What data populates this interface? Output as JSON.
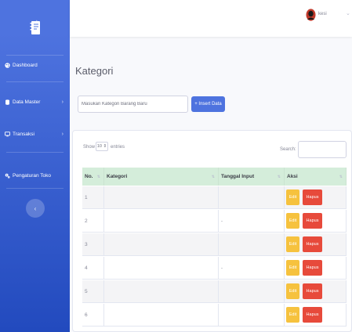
{
  "sidebar": {
    "brand_icon": "notebook-icon",
    "items": [
      {
        "label": "Dashboard",
        "icon": "palette-icon",
        "has_chevron": false
      },
      {
        "label": "Data Master",
        "icon": "database-icon",
        "has_chevron": true,
        "chevron": "›"
      },
      {
        "label": "Transaksi",
        "icon": "desktop-icon",
        "has_chevron": true,
        "chevron": "›"
      },
      {
        "label": "Pengaturan Toko",
        "icon": "cogs-icon",
        "has_chevron": false
      }
    ],
    "toggle_glyph": "‹"
  },
  "topbar": {
    "user_name": "kesi",
    "chevron": "⌄"
  },
  "main": {
    "page_title": "Kategori",
    "insert": {
      "placeholder": "Masukan Kategori Barang Baru",
      "button_label": "+ Insert Data"
    },
    "table": {
      "show_label": "Show",
      "page_size": "10 ⇕",
      "entries_label": "entries",
      "search_label": "Search:",
      "sort_glyph": "⇅",
      "columns": [
        "No.",
        "Kategori",
        "Tanggal Input",
        "Aksi"
      ],
      "rows": [
        {
          "no": "1",
          "kategori": "",
          "tanggal": ""
        },
        {
          "no": "2",
          "kategori": "",
          "tanggal": "-"
        },
        {
          "no": "3",
          "kategori": "",
          "tanggal": ""
        },
        {
          "no": "4",
          "kategori": "",
          "tanggal": "-"
        },
        {
          "no": "5",
          "kategori": "",
          "tanggal": ""
        },
        {
          "no": "6",
          "kategori": "",
          "tanggal": ""
        }
      ],
      "edit_label": "Edit",
      "delete_label": "Hapus"
    }
  },
  "colors": {
    "sidebar": "#4e73df",
    "header_row": "#d4edda",
    "edit": "#f6c23e",
    "delete": "#e74a3b",
    "primary": "#4e73df"
  }
}
